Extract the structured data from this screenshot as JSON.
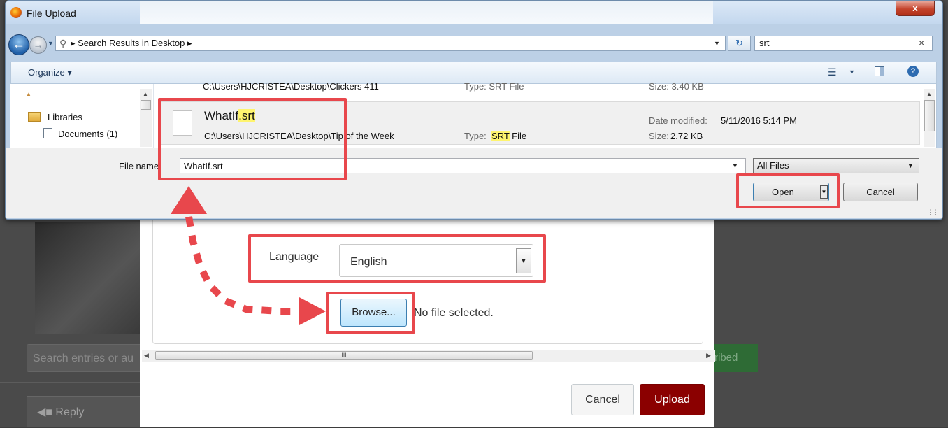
{
  "dialog": {
    "title": "File Upload",
    "close_label": "x",
    "address_crumb": "Search Results in Desktop",
    "search_value": "srt",
    "search_clear": "×",
    "organize_label": "Organize ▾",
    "help_label": "?"
  },
  "nav_pane": {
    "items": [
      {
        "label": "Libraries"
      },
      {
        "label": "Documents (1)"
      }
    ]
  },
  "file_list": {
    "previous_row": {
      "path": "C:\\Users\\HJCRISTEA\\Desktop\\Clickers 411",
      "type": "Type: SRT File",
      "size": "Size: 3.40 KB"
    },
    "selected": {
      "name_base": "WhatIf",
      "name_ext": ".srt",
      "path": "C:\\Users\\HJCRISTEA\\Desktop\\Tip of the Week",
      "type_label": "Type:",
      "type_ext": "SRT",
      "type_rest": " File",
      "date_label": "Date modified:",
      "date_value": "5/11/2016 5:14 PM",
      "size_label": "Size:",
      "size_value": "2.72 KB"
    }
  },
  "footer": {
    "file_name_label": "File name:",
    "file_name_value": "WhatIf.srt",
    "filter_value": "All Files",
    "open_label": "Open",
    "cancel_label": "Cancel"
  },
  "modal": {
    "language_label": "Language",
    "language_value": "English",
    "browse_label": "Browse...",
    "no_file_text": "No file selected.",
    "scroll_marker": "III",
    "cancel_label": "Cancel",
    "upload_label": "Upload"
  },
  "background": {
    "search_placeholder": "Search entries or au",
    "subscribe_label": "ribed",
    "reply_label": "Reply"
  },
  "colors": {
    "callout": "#e8474c",
    "upload_button": "#8b0000",
    "highlight": "#fef46f"
  }
}
